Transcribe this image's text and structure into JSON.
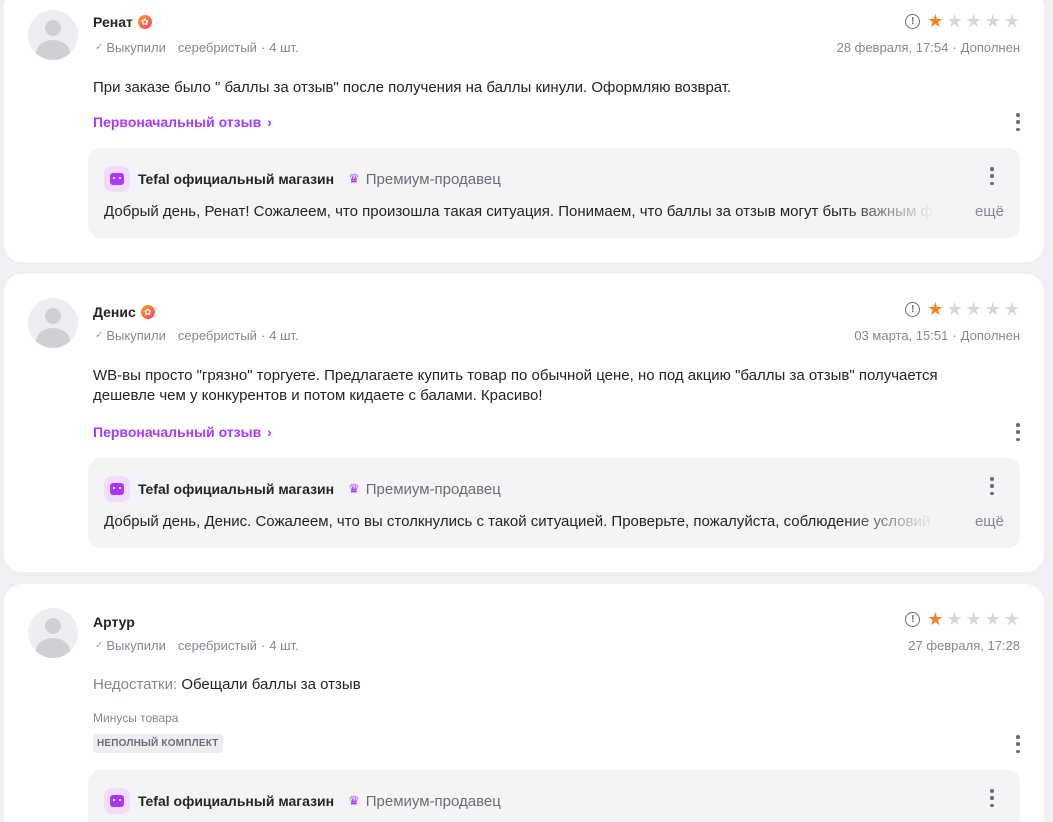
{
  "reviews": [
    {
      "name": "Ренат",
      "status": "Выкупили",
      "variant": "серебристый",
      "qty": "4 шт.",
      "rating": 1,
      "date": "28 февраля, 17:54",
      "edited": "Дополнен",
      "text": "При заказе было \" баллы за отзыв\" после получения на баллы кинули. Оформляю возврат.",
      "original_link": "Первоначальный отзыв",
      "reply": {
        "shop": "Tefal официальный магазин",
        "premium": "Премиум-продавец",
        "text": "Добрый день, Ренат! Сожалеем, что произошла такая ситуация. Понимаем, что баллы за отзыв могут быть важным фактором",
        "more": "ещё"
      }
    },
    {
      "name": "Денис",
      "status": "Выкупили",
      "variant": "серебристый",
      "qty": "4 шт.",
      "rating": 1,
      "date": "03 марта, 15:51",
      "edited": "Дополнен",
      "text": "WB-вы просто \"грязно\" торгуете. Предлагаете купить товар по обычной цене, но под акцию \"баллы за отзыв\" получается дешевле чем у конкурентов и потом кидаете с балами. Красиво!",
      "original_link": "Первоначальный отзыв",
      "reply": {
        "shop": "Tefal официальный магазин",
        "premium": "Премиум-продавец",
        "text": "Добрый день, Денис. Сожалеем, что вы столкнулись с такой ситуацией. Проверьте, пожалуйста, соблюдение условий акции",
        "more": "ещё"
      }
    },
    {
      "name": "Артур",
      "status": "Выкупили",
      "variant": "серебристый",
      "qty": "4 шт.",
      "rating": 1,
      "date": "27 февраля, 17:28",
      "cons_label": "Недостатки:",
      "cons_value": "Обещали баллы за отзыв",
      "minus_title": "Минусы товара",
      "tag": "НЕПОЛНЫЙ КОМПЛЕКТ",
      "reply": {
        "shop": "Tefal официальный магазин",
        "premium": "Премиум-продавец"
      }
    }
  ],
  "colors": {
    "accent": "#a73afd",
    "star_filled": "#f58220",
    "star_empty": "#d6d6e0",
    "background": "#f0f0f4"
  },
  "icons": {
    "rating_info": "info-icon",
    "star": "star-icon",
    "check": "check-icon",
    "badge": "flower-badge-icon",
    "shop": "shop-icon",
    "premium": "crown-icon",
    "menu": "kebab-menu-icon",
    "chevron": "chevron-right-icon"
  }
}
